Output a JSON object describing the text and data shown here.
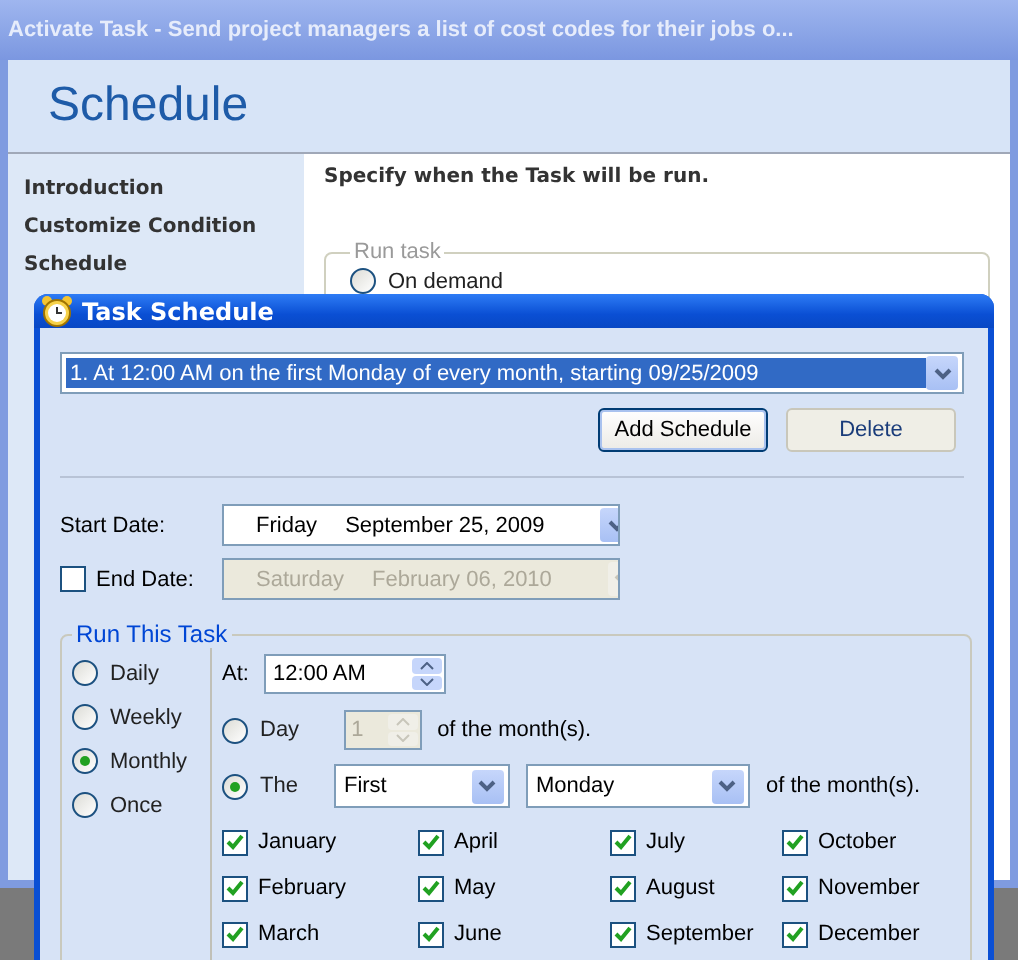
{
  "main_window": {
    "title": "Activate Task - Send project managers a list of cost codes for their jobs o...",
    "header": "Schedule",
    "sidebar": {
      "items": [
        {
          "label": "Introduction"
        },
        {
          "label": "Customize Condition"
        },
        {
          "label": "Schedule"
        }
      ]
    },
    "content": {
      "instruction": "Specify when the Task will be run.",
      "run_task": {
        "legend": "Run task",
        "options": [
          {
            "label": "On demand",
            "selected": false
          }
        ]
      }
    }
  },
  "dialog": {
    "title": "Task Schedule",
    "schedule_list": {
      "value": "1. At 12:00 AM on the first Monday of every month, starting 09/25/2009"
    },
    "buttons": [
      {
        "label": "Add Schedule",
        "default": true
      },
      {
        "label": "Delete",
        "default": false
      }
    ],
    "start_date": {
      "label": "Start Date:",
      "day": "Friday",
      "date": "September 25, 2009"
    },
    "end_date": {
      "label": "End Date:",
      "checked": false,
      "day": "Saturday",
      "date": "February 06, 2010"
    },
    "run_group": {
      "legend": "Run This Task",
      "frequencies": [
        {
          "label": "Daily",
          "selected": false
        },
        {
          "label": "Weekly",
          "selected": false
        },
        {
          "label": "Monthly",
          "selected": true
        },
        {
          "label": "Once",
          "selected": false
        }
      ],
      "at": {
        "label": "At:",
        "value": "12:00 AM"
      },
      "day_option": {
        "label": "Day",
        "selected": false,
        "value": "1",
        "suffix": "of the month(s)."
      },
      "the_option": {
        "label": "The",
        "selected": true,
        "ordinal": "First",
        "weekday": "Monday",
        "suffix": "of the month(s)."
      },
      "months": [
        {
          "label": "January",
          "checked": true
        },
        {
          "label": "April",
          "checked": true
        },
        {
          "label": "July",
          "checked": true
        },
        {
          "label": "October",
          "checked": true
        },
        {
          "label": "February",
          "checked": true
        },
        {
          "label": "May",
          "checked": true
        },
        {
          "label": "August",
          "checked": true
        },
        {
          "label": "November",
          "checked": true
        },
        {
          "label": "March",
          "checked": true
        },
        {
          "label": "June",
          "checked": true
        },
        {
          "label": "September",
          "checked": true
        },
        {
          "label": "December",
          "checked": true
        }
      ]
    }
  }
}
